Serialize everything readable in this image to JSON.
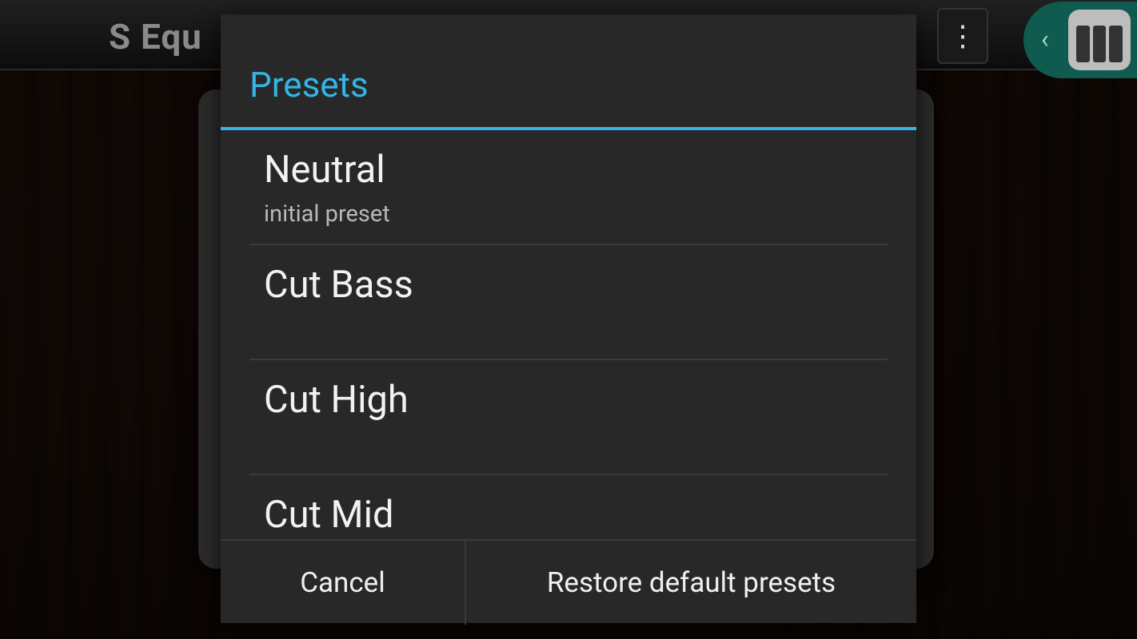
{
  "app": {
    "title": "S Equ",
    "menu_icon": "overflow-menu-icon",
    "overlay_icon": "piano-icon"
  },
  "dialog": {
    "title": "Presets",
    "accent_color": "#33b5e5",
    "items": [
      {
        "name": "Neutral",
        "subtitle": "initial preset"
      },
      {
        "name": "Cut Bass",
        "subtitle": ""
      },
      {
        "name": "Cut High",
        "subtitle": ""
      },
      {
        "name": "Cut Mid",
        "subtitle": ""
      }
    ],
    "buttons": {
      "cancel": "Cancel",
      "restore": "Restore default presets"
    }
  }
}
